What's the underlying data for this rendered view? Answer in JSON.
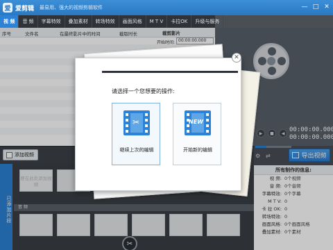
{
  "app": {
    "name": "爱剪辑",
    "slogan": "最易用、强大的视频剪辑软件",
    "logo_char": "爱"
  },
  "window_controls": {
    "minimize": "—",
    "maximize": "□",
    "close": "✕"
  },
  "tabs": [
    {
      "label": "视  频",
      "active": true
    },
    {
      "label": "音  频"
    },
    {
      "label": "字幕特效"
    },
    {
      "label": "叠加素材"
    },
    {
      "label": "转场特效"
    },
    {
      "label": "画面风格"
    },
    {
      "label": "M T V"
    },
    {
      "label": "卡拉OK"
    },
    {
      "label": "升级与服务"
    }
  ],
  "table": {
    "headers": [
      "序号",
      "文件名",
      "在最终影片中的时间",
      "截取时长"
    ]
  },
  "time_panel": {
    "title": "裁剪影片",
    "start_label": "开始时间:",
    "start_value": "00:00:00.000"
  },
  "preview": {
    "time_current": "00:00:00.000",
    "time_total": "00:00:00.000"
  },
  "buttons": {
    "add_video": "添加视频",
    "export": "导出视频"
  },
  "timeline": {
    "side_tab": "已添加片段",
    "placeholder": "要在此处添加视频",
    "audio_track": "音  频"
  },
  "info": {
    "title": "所有制作的信息:",
    "rows": [
      {
        "k": "视  频:",
        "v": "0个视频"
      },
      {
        "k": "音  频:",
        "v": "0个音频"
      },
      {
        "k": "字幕特效:",
        "v": "0个字幕"
      },
      {
        "k": "M T V:",
        "v": "0"
      },
      {
        "k": "卡 拉 OK:",
        "v": "0"
      },
      {
        "k": "转场特效:",
        "v": "0"
      },
      {
        "k": "画面风格:",
        "v": "0个画面风格"
      },
      {
        "k": "叠加素材:",
        "v": "0个素材"
      }
    ]
  },
  "dialog": {
    "question": "请选择一个您想要的操作:",
    "option_continue": "继续上次的编辑",
    "option_new": "开始新的编辑",
    "new_badge": "NEW",
    "close": "✕"
  },
  "icons": {
    "scissor": "✂",
    "settings": "⚙",
    "share": "⇄"
  },
  "colors": {
    "accent": "#2c82d6",
    "titlebar": "#2a78c2",
    "toolbar_dark": "#2f3338"
  }
}
